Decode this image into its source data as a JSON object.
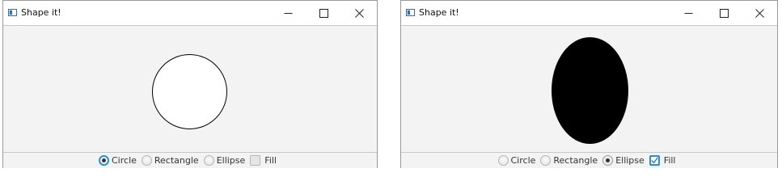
{
  "windows": [
    {
      "title": "Shape it!",
      "shape": "circle",
      "fill": false,
      "controls": {
        "circle_label": "Circle",
        "rectangle_label": "Rectangle",
        "ellipse_label": "Ellipse",
        "fill_label": "Fill",
        "selected": "circle",
        "fill_checked": false
      }
    },
    {
      "title": "Shape it!",
      "shape": "ellipse",
      "fill": true,
      "controls": {
        "circle_label": "Circle",
        "rectangle_label": "Rectangle",
        "ellipse_label": "Ellipse",
        "fill_label": "Fill",
        "selected": "ellipse",
        "fill_checked": true
      }
    }
  ],
  "icons": {
    "app": "app-window-icon",
    "minimize": "minimize-icon",
    "maximize": "maximize-icon",
    "close": "close-icon",
    "check": "checkmark-icon"
  },
  "colors": {
    "focus_accent": "#2a8fd8",
    "canvas_bg": "#f3f3f3",
    "shape_stroke": "#000000",
    "shape_fill": "#000000"
  }
}
